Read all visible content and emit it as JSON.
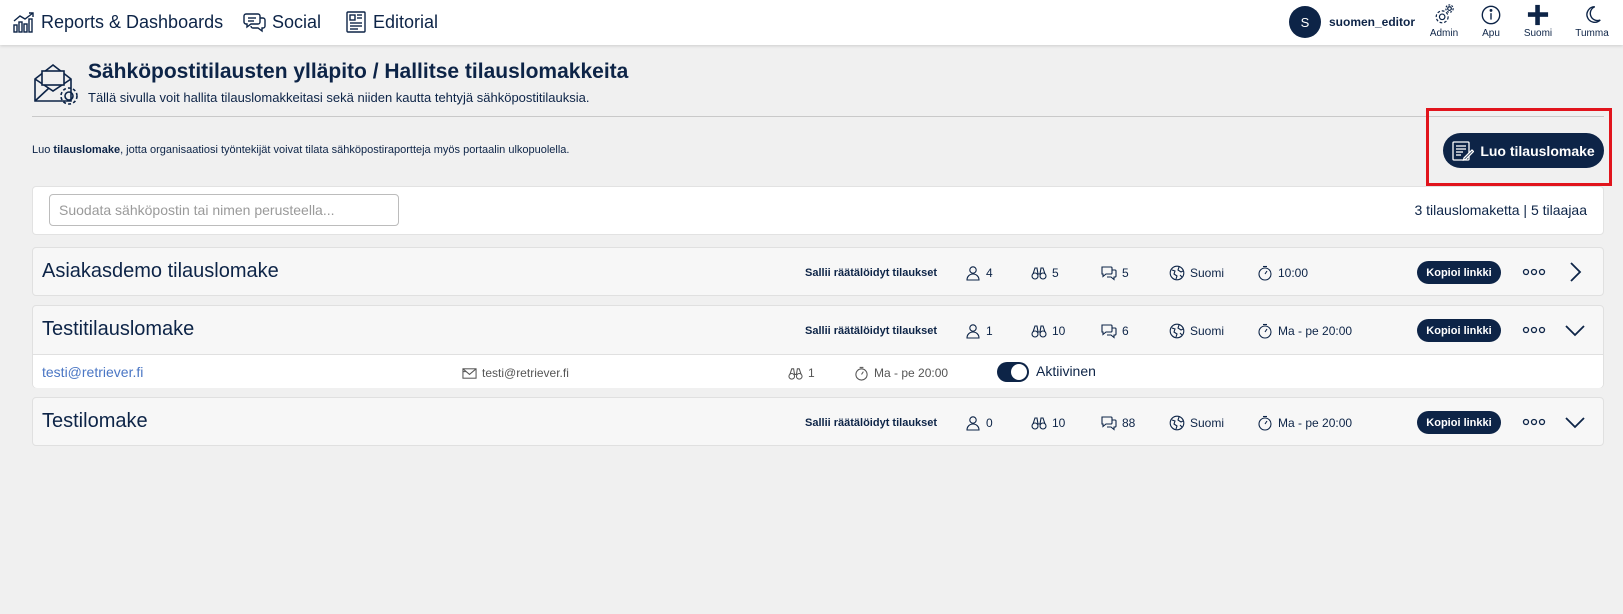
{
  "nav": {
    "reports": "Reports & Dashboards",
    "social": "Social",
    "editorial": "Editorial"
  },
  "user": {
    "initial": "S",
    "name": "suomen_editor"
  },
  "tools": {
    "admin": "Admin",
    "help": "Apu",
    "language": "Suomi",
    "theme": "Tumma"
  },
  "page": {
    "title": "Sähköpostitilausten ylläpito / Hallitse tilauslomakkeita",
    "subtitle": "Tällä sivulla voit hallita tilauslomakkeitasi sekä niiden kautta tehtyjä sähköpostitilauksia.",
    "intro_prefix": "Luo ",
    "intro_bold": "tilauslomake",
    "intro_suffix": ", jotta organisaatiosi työntekijät voivat tilata sähköpostiraportteja myös portaalin ulkopuolella.",
    "create_button": "Luo tilauslomake"
  },
  "filter": {
    "placeholder": "Suodata sähköpostin tai nimen perusteella...",
    "counts": "3 tilauslomaketta  |  5 tilaajaa"
  },
  "forms": [
    {
      "name": "Asiakasdemo tilauslomake",
      "custom": "Sallii räätälöidyt tilaukset",
      "users": "4",
      "searches": "5",
      "comments": "5",
      "language": "Suomi",
      "schedule": "10:00",
      "copy": "Kopioi linkki",
      "expanded": false
    },
    {
      "name": "Testitilauslomake",
      "custom": "Sallii räätälöidyt tilaukset",
      "users": "1",
      "searches": "10",
      "comments": "6",
      "language": "Suomi",
      "schedule": "Ma - pe 20:00",
      "copy": "Kopioi linkki",
      "expanded": true,
      "subscriber": {
        "email": "testi@retriever.fi",
        "mail": "testi@retriever.fi",
        "searches": "1",
        "schedule": "Ma - pe 20:00",
        "status": "Aktiivinen"
      }
    },
    {
      "name": "Testilomake",
      "custom": "Sallii räätälöidyt tilaukset",
      "users": "0",
      "searches": "10",
      "comments": "88",
      "language": "Suomi",
      "schedule": "Ma - pe 20:00",
      "copy": "Kopioi linkki",
      "expanded": true
    }
  ],
  "colors": {
    "primary": "#0d2447",
    "highlight": "#e1141c",
    "link": "#4a76c4",
    "background": "#f0f0f0"
  }
}
